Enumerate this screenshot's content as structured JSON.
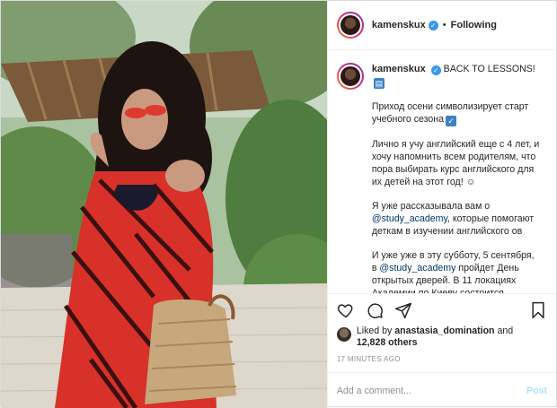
{
  "header": {
    "username": "kamenskux",
    "follow_status": "Following",
    "separator": "•"
  },
  "caption": {
    "username": "kamenskux",
    "title": "BACK TO LESSONS!",
    "paragraphs": [
      "Приход осени символизирует старт учебного сезона",
      "Лично я учу английский еще с 4 лет, и хочу напомнить всем родителям, что пора выбирать курс английского для их детей на этот год! ☺",
      "Я уже рассказывала вам о",
      "И уже уже в эту субботу, 5 сентября, в",
      "пройдет День открытых дверей. В 11 локациях Академии по Киеву состоится"
    ],
    "mention": "@study_academy",
    "p3_rest": ", которые помогают деткам в изучении английского ов"
  },
  "likes": {
    "prefix": "Liked by",
    "user": "anastasia_domination",
    "and": "and",
    "count": "12,828 others"
  },
  "timestamp": "17 MINUTES AGO",
  "comment": {
    "placeholder": "Add a comment...",
    "post_label": "Post"
  },
  "icons": {
    "like": "heart-icon",
    "comment": "comment-icon",
    "share": "share-icon",
    "save": "bookmark-icon",
    "verified": "verified-badge-icon"
  },
  "colors": {
    "accent": "#3897f0",
    "post_disabled": "#b2dffc",
    "muted": "#8e8e8e"
  }
}
